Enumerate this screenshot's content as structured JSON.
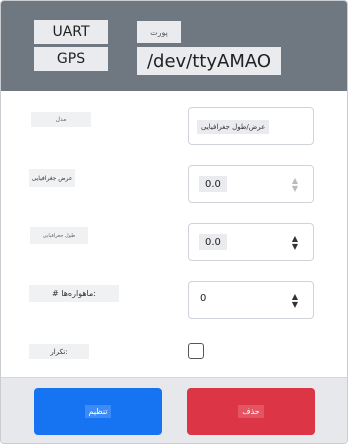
{
  "header": {
    "uart_label": "UART",
    "gps_label": "GPS",
    "port_label": "پورت",
    "device_path": "/dev/ttyAMAO"
  },
  "form": {
    "fields": [
      {
        "label": "مدل",
        "value": "عرض/طول جغرافیایی"
      },
      {
        "label": "عرض جغرافیایی",
        "value": "0.0"
      },
      {
        "label": "طول جغرافیایی",
        "value": "0.0"
      },
      {
        "label": "# ماهواره‌ها:",
        "value": "0"
      },
      {
        "label": "تکرار:"
      }
    ]
  },
  "footer": {
    "ok_label": "تنظیم",
    "delete_label": "حذف"
  },
  "colors": {
    "header_bg": "#6f7880",
    "primary": "#1673f1",
    "danger": "#dc3545"
  }
}
